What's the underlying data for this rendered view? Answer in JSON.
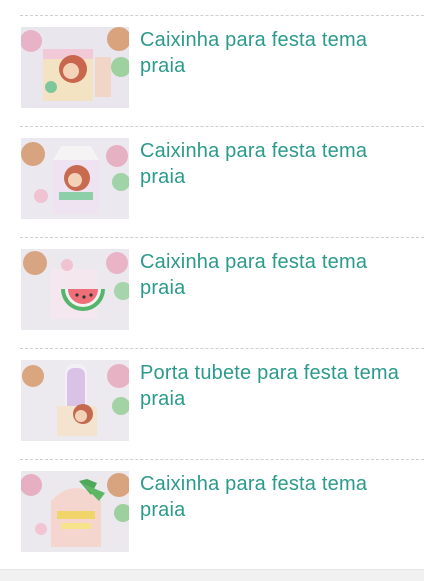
{
  "products": [
    {
      "title": "Caixinha para festa tema praia",
      "image_icon": "product-thumbnail"
    },
    {
      "title": "Caixinha para festa tema praia",
      "image_icon": "product-thumbnail"
    },
    {
      "title": "Caixinha para festa tema praia",
      "image_icon": "product-thumbnail"
    },
    {
      "title": "Porta tubete para festa tema praia",
      "image_icon": "product-thumbnail"
    },
    {
      "title": "Caixinha para festa tema praia",
      "image_icon": "product-thumbnail"
    }
  ],
  "colors": {
    "title_color": "#2b9a8c",
    "divider_color": "#cfcfcf",
    "footer_color": "#f1f1f1"
  }
}
